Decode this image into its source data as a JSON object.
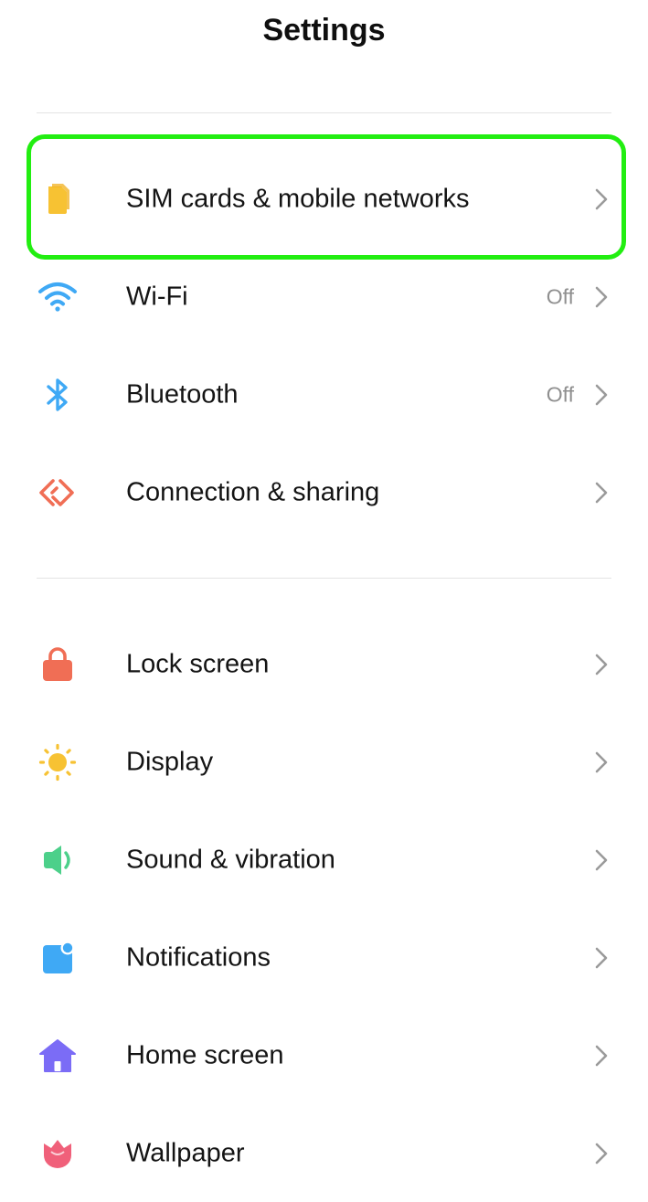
{
  "header": {
    "title": "Settings"
  },
  "sections": [
    {
      "items": [
        {
          "id": "sim",
          "label": "SIM cards & mobile networks",
          "icon": "sim-card-icon",
          "value": "",
          "color": "#F7C233"
        },
        {
          "id": "wifi",
          "label": "Wi-Fi",
          "icon": "wifi-icon",
          "value": "Off",
          "color": "#3FA9F5"
        },
        {
          "id": "bluetooth",
          "label": "Bluetooth",
          "icon": "bluetooth-icon",
          "value": "Off",
          "color": "#3FA9F5"
        },
        {
          "id": "connection",
          "label": "Connection & sharing",
          "icon": "connection-sharing-icon",
          "value": "",
          "color": "#F06E55"
        }
      ]
    },
    {
      "items": [
        {
          "id": "lock",
          "label": "Lock screen",
          "icon": "lock-icon",
          "value": "",
          "color": "#F06E55"
        },
        {
          "id": "display",
          "label": "Display",
          "icon": "sun-icon",
          "value": "",
          "color": "#F7C233"
        },
        {
          "id": "sound",
          "label": "Sound & vibration",
          "icon": "speaker-icon",
          "value": "",
          "color": "#4CD08A"
        },
        {
          "id": "notifications",
          "label": "Notifications",
          "icon": "notification-icon",
          "value": "",
          "color": "#3FA9F5"
        },
        {
          "id": "home",
          "label": "Home screen",
          "icon": "home-icon",
          "value": "",
          "color": "#7B6CF6"
        },
        {
          "id": "wallpaper",
          "label": "Wallpaper",
          "icon": "tulip-icon",
          "value": "",
          "color": "#F0607A"
        }
      ]
    }
  ],
  "highlight_color": "#22EE11"
}
